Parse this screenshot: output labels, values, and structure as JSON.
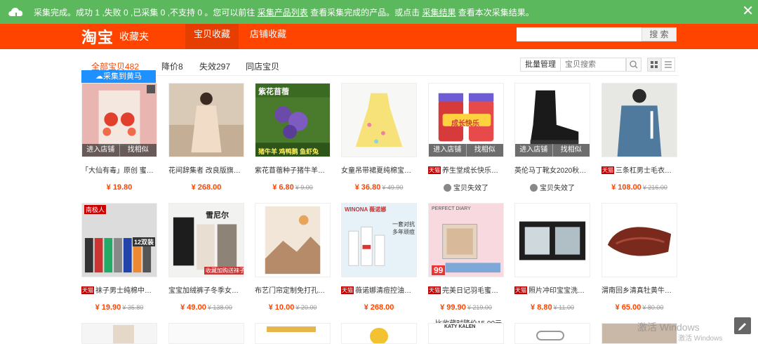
{
  "notification": {
    "message": "采集完成。成功 1 ,失败 0 ,已采集 0 ,不支持 0 。您可以前往",
    "link1": "采集产品列表",
    "middle": "查看采集完成的产品。或点击",
    "link2": "采集结果",
    "end": "查看本次采集结果。",
    "close": "✕"
  },
  "header": {
    "logo": "淘宝",
    "logo_sub": "收藏夹",
    "tabs": [
      "宝贝收藏",
      "店铺收藏"
    ],
    "search_button": "搜 索"
  },
  "filters": {
    "tabs": [
      "全部宝贝482",
      "降价8",
      "失效297",
      "同店宝贝"
    ],
    "batch": "批量管理",
    "search_placeholder": "宝贝搜索"
  },
  "collect_button": "采集到黄马",
  "hover_actions": [
    "进入店铺",
    "找相似"
  ],
  "tmall_badge": "天猫",
  "items_row1": [
    {
      "title": "「大仙有毒」原创 蜜桃能...",
      "price": "¥ 19.80",
      "old": ""
    },
    {
      "title": "花间辞集者 改良版旗袍连...",
      "price": "¥ 268.00",
      "old": ""
    },
    {
      "title": "紫花苜蓿种子猪牛羊兔鸡...",
      "price": "¥ 6.80",
      "old": "¥ 9.00"
    },
    {
      "title": "女童吊带裙夏纯棉宝宝女...",
      "price": "¥ 36.80",
      "old": "¥ 49.90"
    },
    {
      "title": "养生堂成长快乐复合...",
      "invalid": "宝贝失效了"
    },
    {
      "title": "英伦马丁靴女2020秋冬新...",
      "invalid": "宝贝失效了"
    },
    {
      "title": "三条杠男士毛衣男日...",
      "price": "¥ 108.00",
      "old": "¥ 216.00"
    }
  ],
  "items_row2": [
    {
      "title": "袜子男士纯棉中筒长...",
      "price": "¥ 19.90",
      "old": "¥ 35.80"
    },
    {
      "title": "宝宝加绒裤子冬季女童加...",
      "price": "¥ 49.00",
      "old": "¥ 138.00"
    },
    {
      "title": "布艺门帘定制免打孔家用...",
      "price": "¥ 10.00",
      "old": "¥ 20.00"
    },
    {
      "title": "薇诺娜清痘控油祛痘...",
      "price": "¥ 268.00",
      "old": ""
    },
    {
      "title": "完美日记羽毛蜜粉饼...",
      "price": "¥ 99.90",
      "old": "¥ 219.00",
      "note": "比收藏时降价15.00元"
    },
    {
      "title": "照片冲印宝宝洗照片...",
      "price": "¥ 8.80",
      "old": "¥ 11.00"
    },
    {
      "title": "渭南回乡清真牡黄牛肉干...",
      "price": "¥ 65.00",
      "old": "¥ 80.00"
    }
  ],
  "thumb_labels": {
    "r1_3a": "紫花苜蓿",
    "r1_3b": "猪牛羊 鸡鸭鹅 鱼虾兔",
    "r1_5": "成长快乐",
    "r2_1a": "南极人",
    "r2_1b": "12双装",
    "r2_2": "雪尼尔",
    "r2_2b": "收藏加购送袜子",
    "r2_4": "WINONA 薇诺娜",
    "r2_4b": "一套对抗 多年顽痘",
    "r2_5": "PERFECT DIARY",
    "r2_5b": "99",
    "r3_5": "KATY KALEN"
  },
  "watermark": {
    "line1": "激活 Windows",
    "line2": "激活 Windows"
  }
}
